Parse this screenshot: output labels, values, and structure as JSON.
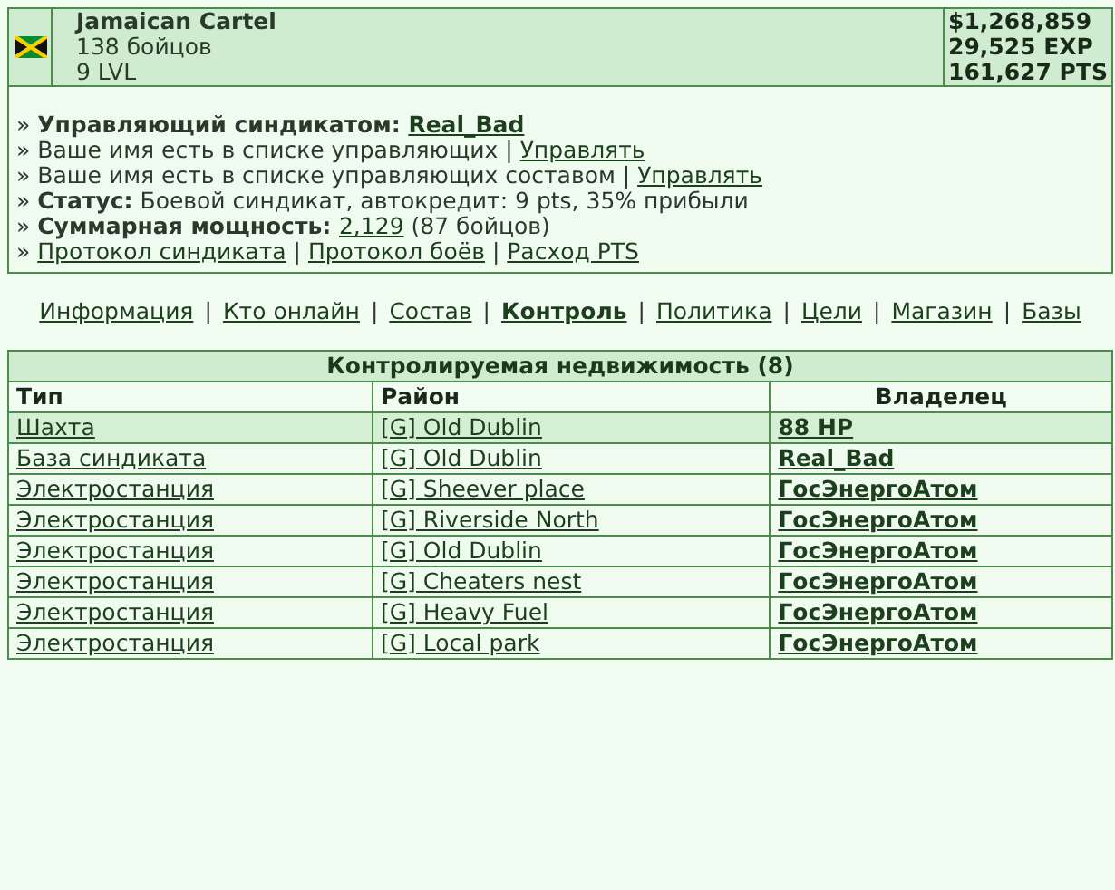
{
  "syndicate": {
    "name": "Jamaican Cartel",
    "members": "138 бойцов",
    "level": "9 LVL",
    "money": "$1,268,859",
    "exp": "29,525 EXP",
    "pts": "161,627 PTS"
  },
  "info_lines": [
    {
      "segments": [
        {
          "kind": "text",
          "text": "» "
        },
        {
          "kind": "bold",
          "text": "Управляющий синдикатом: "
        },
        {
          "kind": "boldlink",
          "text": "Real_Bad"
        }
      ]
    },
    {
      "segments": [
        {
          "kind": "text",
          "text": "» Ваше имя есть в списке управляющих | "
        },
        {
          "kind": "link",
          "text": "Управлять"
        }
      ]
    },
    {
      "segments": [
        {
          "kind": "text",
          "text": "» Ваше имя есть в списке управляющих составом | "
        },
        {
          "kind": "link",
          "text": "Управлять"
        }
      ]
    },
    {
      "segments": [
        {
          "kind": "text",
          "text": "» "
        },
        {
          "kind": "bold",
          "text": "Статус:"
        },
        {
          "kind": "text",
          "text": " Боевой синдикат, автокредит: 9 pts, 35% прибыли"
        }
      ]
    },
    {
      "segments": [
        {
          "kind": "text",
          "text": "» "
        },
        {
          "kind": "bold",
          "text": "Суммарная мощность: "
        },
        {
          "kind": "link",
          "text": "2,129"
        },
        {
          "kind": "text",
          "text": " (87 бойцов)"
        }
      ]
    },
    {
      "segments": [
        {
          "kind": "text",
          "text": "» "
        },
        {
          "kind": "link",
          "text": "Протокол синдиката"
        },
        {
          "kind": "text",
          "text": " | "
        },
        {
          "kind": "link",
          "text": "Протокол боёв"
        },
        {
          "kind": "text",
          "text": " | "
        },
        {
          "kind": "link",
          "text": "Расход PTS"
        }
      ]
    }
  ],
  "nav": [
    {
      "kind": "link",
      "label": "Информация",
      "selected": false
    },
    {
      "kind": "sep",
      "label": "|"
    },
    {
      "kind": "link",
      "label": "Кто онлайн",
      "selected": false
    },
    {
      "kind": "sep",
      "label": "|"
    },
    {
      "kind": "link",
      "label": "Состав",
      "selected": false
    },
    {
      "kind": "sep",
      "label": "|"
    },
    {
      "kind": "link",
      "label": "Контроль",
      "selected": true
    },
    {
      "kind": "sep",
      "label": "|"
    },
    {
      "kind": "link",
      "label": "Политика",
      "selected": false
    },
    {
      "kind": "sep",
      "label": "|"
    },
    {
      "kind": "link",
      "label": "Цели",
      "selected": false
    },
    {
      "kind": "sep",
      "label": "|"
    },
    {
      "kind": "link",
      "label": "Магазин",
      "selected": false
    },
    {
      "kind": "sep",
      "label": "|"
    },
    {
      "kind": "link",
      "label": "Базы",
      "selected": false
    }
  ],
  "table": {
    "title": "Контролируемая недвижимость (8)",
    "columns": [
      "Тип",
      "Район",
      "Владелец"
    ],
    "rows": [
      {
        "type": "Шахта",
        "district": "[G] Old Dublin",
        "owner": "88 HP",
        "highlighted": true
      },
      {
        "type": "База синдиката",
        "district": "[G] Old Dublin",
        "owner": "Real_Bad",
        "highlighted": false
      },
      {
        "type": "Электростанция",
        "district": "[G] Sheever place",
        "owner": "ГосЭнергоАтом",
        "highlighted": false
      },
      {
        "type": "Электростанция",
        "district": "[G] Riverside North",
        "owner": "ГосЭнергоАтом",
        "highlighted": false
      },
      {
        "type": "Электростанция",
        "district": "[G] Old Dublin",
        "owner": "ГосЭнергоАтом",
        "highlighted": false
      },
      {
        "type": "Электростанция",
        "district": "[G] Cheaters nest",
        "owner": "ГосЭнергоАтом",
        "highlighted": false
      },
      {
        "type": "Электростанция",
        "district": "[G] Heavy Fuel",
        "owner": "ГосЭнергоАтом",
        "highlighted": false
      },
      {
        "type": "Электростанция",
        "district": "[G] Local park",
        "owner": "ГосЭнергоАтом",
        "highlighted": false
      }
    ]
  }
}
